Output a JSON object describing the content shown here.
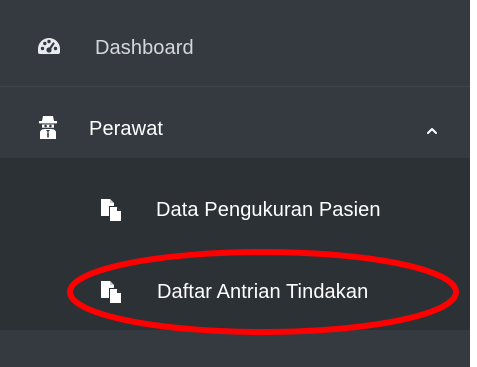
{
  "sidebar": {
    "items": [
      {
        "label": "Dashboard",
        "icon": "tachometer-icon"
      },
      {
        "label": "Perawat",
        "icon": "user-secret-icon",
        "expanded": true,
        "children": [
          {
            "label": "Data Pengukuran Pasien",
            "icon": "copy-icon"
          },
          {
            "label": "Daftar Antrian Tindakan",
            "icon": "copy-icon"
          }
        ]
      }
    ]
  },
  "colors": {
    "sidebar_bg": "#343a40",
    "submenu_bg": "#2c3136",
    "text": "#ffffff",
    "annotation": "#ff0000"
  }
}
